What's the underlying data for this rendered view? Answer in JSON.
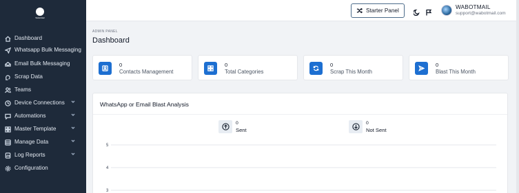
{
  "app": {
    "logo_text": "WaboMail"
  },
  "sidebar": {
    "items": [
      {
        "label": "Dashboard",
        "icon": "home-icon",
        "has_chevron": false
      },
      {
        "label": "Whatsapp Bulk Messaging",
        "icon": "send-icon",
        "has_chevron": false
      },
      {
        "label": "Email Bulk Messaging",
        "icon": "mail-icon",
        "has_chevron": false
      },
      {
        "label": "Scrap Data",
        "icon": "scrap-icon",
        "has_chevron": false
      },
      {
        "label": "Teams",
        "icon": "users-icon",
        "has_chevron": false
      },
      {
        "label": "Device Connections",
        "icon": "device-icon",
        "has_chevron": true
      },
      {
        "label": "Automations",
        "icon": "chat-icon",
        "has_chevron": true
      },
      {
        "label": "Master Template",
        "icon": "template-icon",
        "has_chevron": true
      },
      {
        "label": "Manage Data",
        "icon": "database-icon",
        "has_chevron": true
      },
      {
        "label": "Log Reports",
        "icon": "report-icon",
        "has_chevron": true
      },
      {
        "label": "Configuration",
        "icon": "gear-icon",
        "has_chevron": false
      }
    ]
  },
  "topbar": {
    "plan_button": "Starter Panel",
    "user_name": "WABOTMAIL",
    "user_email": "support@wabotmail.com"
  },
  "page": {
    "breadcrumb": "ADMIN PANEL",
    "title": "Dashboard"
  },
  "stats": [
    {
      "value": "0",
      "label": "Contacts Management",
      "icon": "contacts-icon"
    },
    {
      "value": "0",
      "label": "Total Categories",
      "icon": "grid-icon"
    },
    {
      "value": "0",
      "label": "Scrap This Month",
      "icon": "refresh-icon"
    },
    {
      "value": "0",
      "label": "Blast This Month",
      "icon": "send-icon"
    }
  ],
  "analysis": {
    "title": "WhatsApp or Email Blast Analysis",
    "legend": [
      {
        "value": "0",
        "name": "Sent",
        "icon": "arrow-up-circle-icon"
      },
      {
        "value": "0",
        "name": "Not Sent",
        "icon": "arrow-down-circle-icon"
      }
    ]
  },
  "chart_data": {
    "type": "line",
    "y_ticks": [
      "5",
      "4",
      "3"
    ],
    "ylim": [
      3,
      5
    ],
    "grid": true
  }
}
